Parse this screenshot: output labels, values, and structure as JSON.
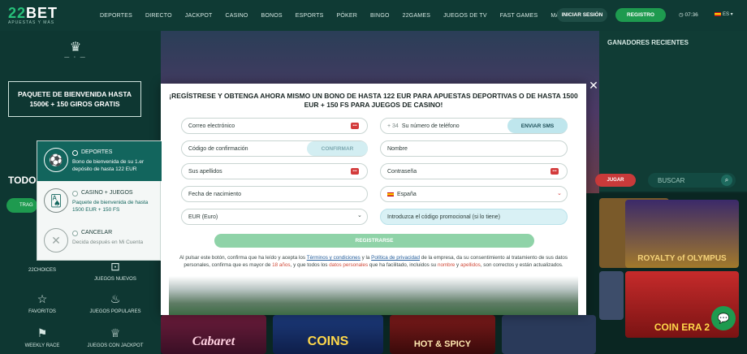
{
  "brand": {
    "name": "22",
    "name2": "BET",
    "tagline": "APUESTAS Y MÁS"
  },
  "nav": [
    "DEPORTES",
    "DIRECTO",
    "JACKPOT",
    "CASINO",
    "BONOS",
    "ESPORTS",
    "PÓKER",
    "BINGO",
    "22GAMES",
    "JUEGOS DE TV",
    "FAST GAMES",
    "MÁS"
  ],
  "header": {
    "login": "INICIAR SESIÓN",
    "register": "REGISTRO",
    "time": "07:36",
    "lang": "ES"
  },
  "left": {
    "promo": "PAQUETE DE BIENVENIDA HASTA 1500€ + 150 GIROS GRATIS",
    "section_title": "TODO",
    "tab": "TRAG"
  },
  "categories": [
    "22CHOICES",
    "JUEGOS NUEVOS",
    "FAVORITOS",
    "JUEGOS POPULARES",
    "WEEKLY RACE",
    "JUEGOS CON JACKPOT"
  ],
  "winners_title": "GANADORES RECIENTES",
  "right": {
    "jugar": "JUGAR",
    "search": "BUSCAR"
  },
  "games": [
    "Cabaret",
    "COINS",
    "HOT & SPICY",
    "ROYALTY of OLYMPUS",
    "COIN ERA 2"
  ],
  "bonus": [
    {
      "title": "DEPORTES",
      "desc": "Bono de bienvenida de su 1.er depósito de hasta 122 EUR"
    },
    {
      "title": "CASINO + JUEGOS",
      "desc": "Paquete de bienvenida de hasta 1500 EUR + 150 FS"
    },
    {
      "title": "CANCELAR",
      "desc": "Decida después en Mi Cuenta"
    }
  ],
  "modal": {
    "title": "¡REGÍSTRESE Y OBTENGA AHORA MISMO UN BONO DE HASTA 122 EUR PARA APUESTAS DEPORTIVAS O DE HASTA 1500 EUR + 150 FS PARA JUEGOS DE CASINO!",
    "email": "Correo electrónico",
    "phone_prefix": "+ 34",
    "phone": "Su número de teléfono",
    "send_sms": "ENVIAR SMS",
    "code": "Código de confirmación",
    "confirm": "CONFIRMAR",
    "name": "Nombre",
    "surname": "Sus apellidos",
    "password": "Contraseña",
    "birth": "Fecha de nacimiento",
    "country": "España",
    "currency": "EUR (Euro)",
    "promo_code": "Introduzca el código promocional (si lo tiene)",
    "submit": "REGISTRARSE",
    "legal_1": "Al pulsar este botón, confirma que ha leído y acepta los",
    "legal_terms": "Términos y condiciones",
    "legal_2": "y la",
    "legal_privacy": "Política de privacidad",
    "legal_3": "de la empresa, da su consentimiento al tratamiento de sus datos personales, confirma que es mayor de",
    "legal_age": "18 años",
    "legal_4": ", y que todos los",
    "legal_data": "datos personales",
    "legal_5": "que ha facilitado, incluidos su",
    "legal_name": "nombre",
    "legal_6": "y",
    "legal_surname": "apellidos",
    "legal_7": ", son correctos y están actualizados."
  },
  "colors": {
    "accent": "#1e9a4f",
    "dark": "#0f3a34",
    "error": "#d33b3b"
  }
}
